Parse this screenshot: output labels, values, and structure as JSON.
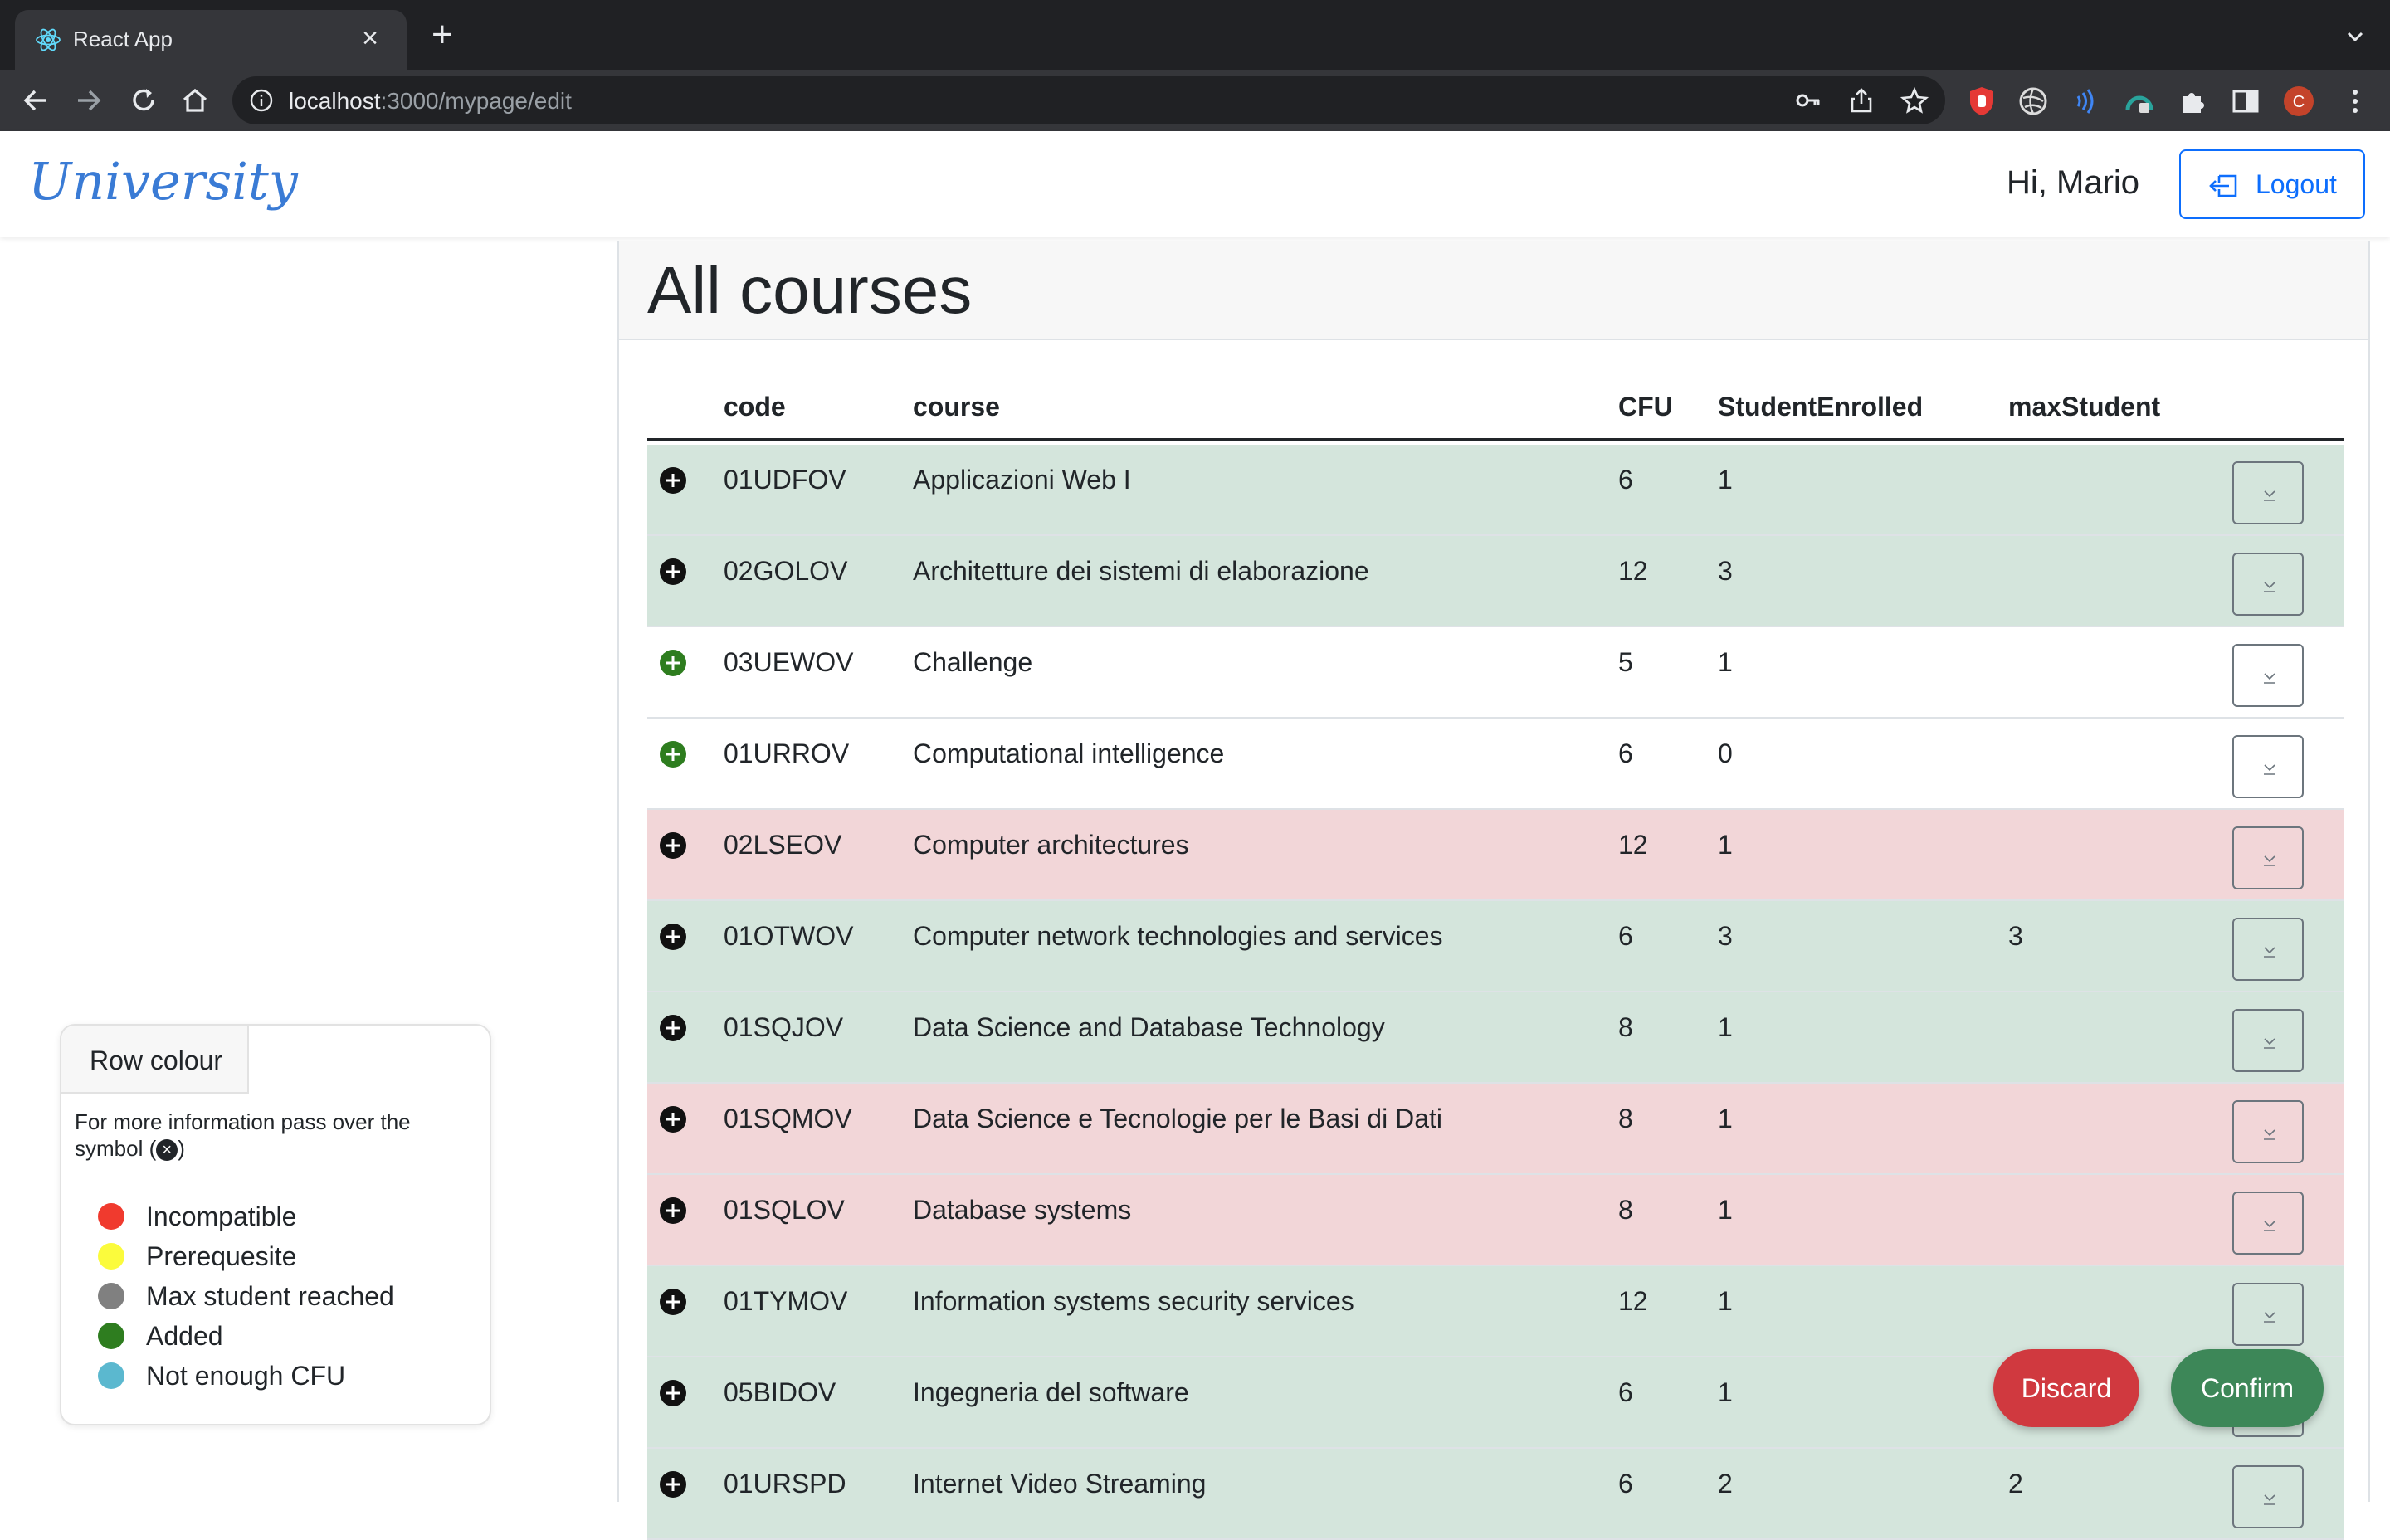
{
  "browser": {
    "tab_title": "React App",
    "url_host": "localhost",
    "url_rest": ":3000/mypage/edit"
  },
  "navbar": {
    "brand": "University",
    "greeting": "Hi, Mario",
    "logout_label": "Logout"
  },
  "main": {
    "title": "All courses",
    "columns": {
      "code": "code",
      "course": "course",
      "cfu": "CFU",
      "enrolled": "StudentEnrolled",
      "max": "maxStudent"
    },
    "rows": [
      {
        "code": "01UDFOV",
        "course": "Applicazioni Web I",
        "cfu": "6",
        "enrolled": "1",
        "max": "",
        "status": "green",
        "icon_color": "#111111"
      },
      {
        "code": "02GOLOV",
        "course": "Architetture dei sistemi di elaborazione",
        "cfu": "12",
        "enrolled": "3",
        "max": "",
        "status": "green",
        "icon_color": "#111111"
      },
      {
        "code": "03UEWOV",
        "course": "Challenge",
        "cfu": "5",
        "enrolled": "1",
        "max": "",
        "status": "white",
        "icon_color": "#2e7d1f"
      },
      {
        "code": "01URROV",
        "course": "Computational intelligence",
        "cfu": "6",
        "enrolled": "0",
        "max": "",
        "status": "white",
        "icon_color": "#2e7d1f"
      },
      {
        "code": "02LSEOV",
        "course": "Computer architectures",
        "cfu": "12",
        "enrolled": "1",
        "max": "",
        "status": "red",
        "icon_color": "#111111"
      },
      {
        "code": "01OTWOV",
        "course": "Computer network technologies and services",
        "cfu": "6",
        "enrolled": "3",
        "max": "3",
        "status": "green",
        "icon_color": "#111111"
      },
      {
        "code": "01SQJOV",
        "course": "Data Science and Database Technology",
        "cfu": "8",
        "enrolled": "1",
        "max": "",
        "status": "green",
        "icon_color": "#111111"
      },
      {
        "code": "01SQMOV",
        "course": "Data Science e Tecnologie per le Basi di Dati",
        "cfu": "8",
        "enrolled": "1",
        "max": "",
        "status": "red",
        "icon_color": "#111111"
      },
      {
        "code": "01SQLOV",
        "course": "Database systems",
        "cfu": "8",
        "enrolled": "1",
        "max": "",
        "status": "red",
        "icon_color": "#111111"
      },
      {
        "code": "01TYMOV",
        "course": "Information systems security services",
        "cfu": "12",
        "enrolled": "1",
        "max": "",
        "status": "green",
        "icon_color": "#111111"
      },
      {
        "code": "05BIDOV",
        "course": "Ingegneria del software",
        "cfu": "6",
        "enrolled": "1",
        "max": "",
        "status": "green",
        "icon_color": "#111111"
      },
      {
        "code": "01URSPD",
        "course": "Internet Video Streaming",
        "cfu": "6",
        "enrolled": "2",
        "max": "2",
        "status": "green",
        "icon_color": "#111111"
      }
    ]
  },
  "legend": {
    "title": "Row colour",
    "hint_before": "For more information pass over the symbol (",
    "hint_after": ")",
    "items": [
      {
        "label": "Incompatible",
        "color": "#f03a2e"
      },
      {
        "label": "Prerequesite",
        "color": "#fbfb3c"
      },
      {
        "label": "Max student reached",
        "color": "#808080"
      },
      {
        "label": "Added",
        "color": "#2e7d1f"
      },
      {
        "label": "Not enough CFU",
        "color": "#5bb8cf"
      }
    ]
  },
  "actions": {
    "discard_label": "Discard",
    "confirm_label": "Confirm"
  }
}
